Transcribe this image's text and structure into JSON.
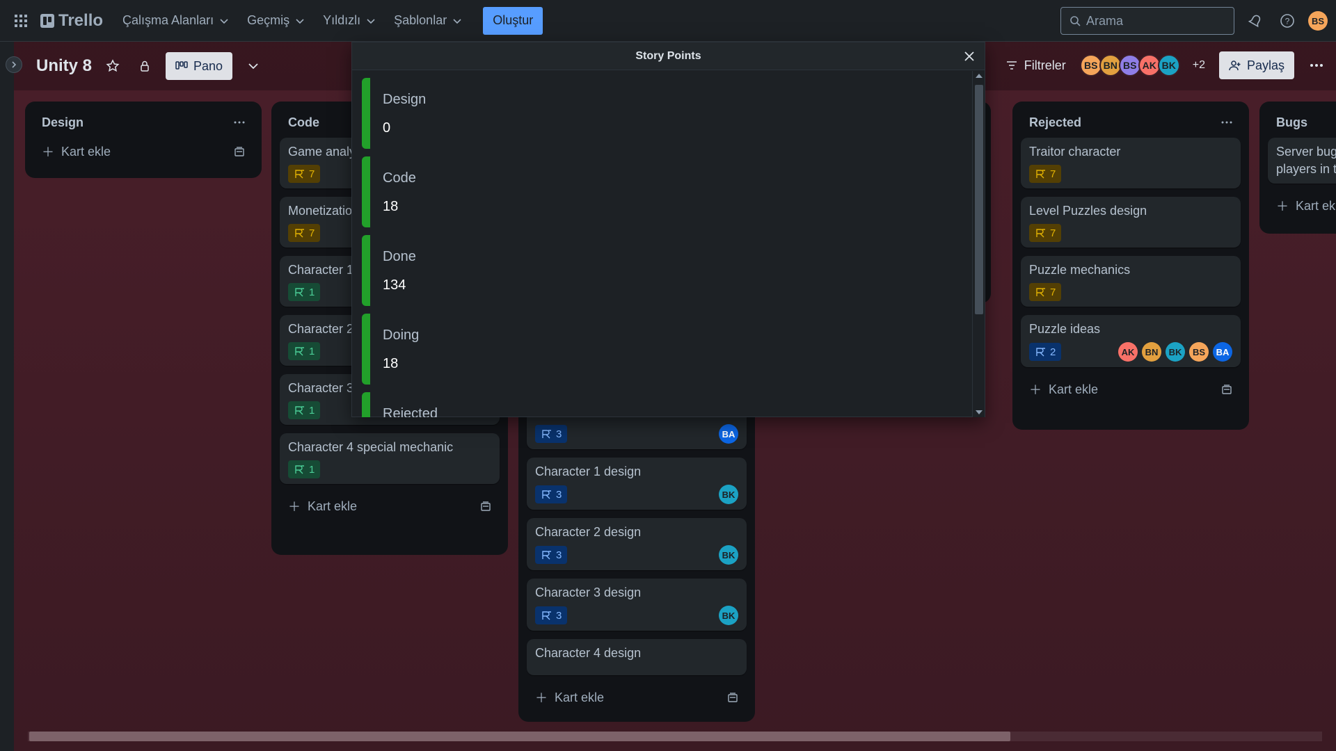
{
  "topbar": {
    "logo": "Trello",
    "menu": [
      "Çalışma Alanları",
      "Geçmiş",
      "Yıldızlı",
      "Şablonlar"
    ],
    "create": "Oluştur",
    "search_placeholder": "Arama",
    "user_avatar": "BS"
  },
  "board": {
    "title": "Unity 8",
    "view": "Pano",
    "filters": "Filtreler",
    "members": [
      {
        "initials": "BS",
        "color": "#f5a55a"
      },
      {
        "initials": "BN",
        "color": "#e2a03f"
      },
      {
        "initials": "BS",
        "color": "#8f7ee7"
      },
      {
        "initials": "AK",
        "color": "#f87168"
      },
      {
        "initials": "BK",
        "color": "#1ba2c4"
      }
    ],
    "more_members": "+2",
    "share": "Paylaş"
  },
  "add_card_label": "Kart ekle",
  "lists": {
    "design": {
      "title": "Design"
    },
    "code": {
      "title": "Code",
      "cards": [
        {
          "title": "Game analysis",
          "points": "7"
        },
        {
          "title": "Monetization",
          "points": "7"
        },
        {
          "title": "Character 1",
          "points": "1"
        },
        {
          "title": "Character 2",
          "points": "1"
        },
        {
          "title": "Character 3",
          "points": "1"
        },
        {
          "title": "Character 4 special mechanic",
          "points": "1"
        }
      ]
    },
    "doing": {
      "cards": [
        {
          "title": "",
          "points": "3",
          "member": "BA"
        },
        {
          "title": "Character 1 design",
          "points": "3",
          "member": "BK"
        },
        {
          "title": "Character 2 design",
          "points": "3",
          "member": "BK"
        },
        {
          "title": "Character 3 design",
          "points": "3",
          "member": "BK"
        },
        {
          "title": "Character 4 design",
          "points": "3",
          "member": "BK"
        }
      ]
    },
    "rejected": {
      "title": "Rejected",
      "cards": [
        {
          "title": "Traitor character",
          "points": "7"
        },
        {
          "title": "Level Puzzles design",
          "points": "7"
        },
        {
          "title": "Puzzle mechanics",
          "points": "7"
        },
        {
          "title": "Puzzle ideas",
          "points": "2",
          "members": [
            "AK",
            "BN",
            "BK",
            "BS",
            "BA"
          ]
        }
      ]
    },
    "bugs": {
      "title": "Bugs",
      "cards": [
        {
          "title_line1": "Server bug",
          "title_line2": "players in t"
        }
      ]
    }
  },
  "member_colors": {
    "AK": "#f87168",
    "BN": "#e2a03f",
    "BK": "#1ba2c4",
    "BS": "#f5a55a",
    "BA": "#0c66e4"
  },
  "modal": {
    "title": "Story Points",
    "items": [
      {
        "name": "Design",
        "value": "0"
      },
      {
        "name": "Code",
        "value": "18"
      },
      {
        "name": "Done",
        "value": "134"
      },
      {
        "name": "Doing",
        "value": "18"
      },
      {
        "name": "Rejected",
        "value": ""
      }
    ],
    "bar_color": "#22a02a"
  }
}
